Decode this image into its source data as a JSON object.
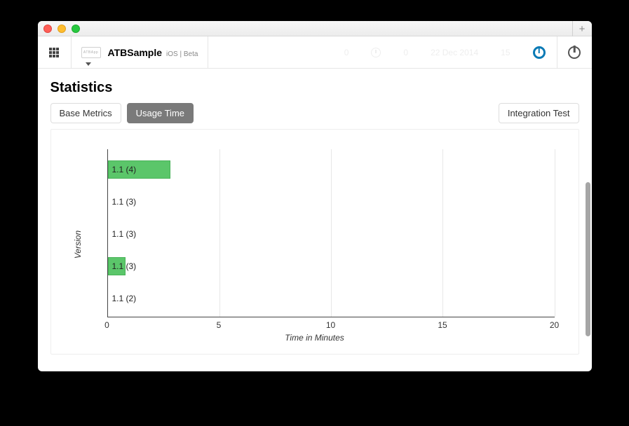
{
  "window": {
    "new_tab_glyph": "+"
  },
  "toolbar": {
    "app_icon_text": "ATBApp",
    "app_name": "ATBSample",
    "app_tag": "iOS | Beta",
    "faded_count_a": "0",
    "faded_count_b": "0",
    "faded_date": "22 Dec 2014",
    "faded_time": "15"
  },
  "page": {
    "title": "Statistics",
    "tab_base_metrics": "Base Metrics",
    "tab_usage_time": "Usage Time",
    "btn_integration_test": "Integration Test"
  },
  "chart_data": {
    "type": "bar",
    "orientation": "horizontal",
    "ylabel": "Version",
    "xlabel": "Time in Minutes",
    "xlim": [
      0,
      20
    ],
    "xticks": [
      0,
      5,
      10,
      15,
      20
    ],
    "categories": [
      "1.1 (4)",
      "1.1 (3)",
      "1.1 (3)",
      "1.1 (3)",
      "1.1 (2)"
    ],
    "values": [
      2.8,
      0,
      0,
      0.8,
      0
    ],
    "bar_color": "#5bc66a"
  }
}
